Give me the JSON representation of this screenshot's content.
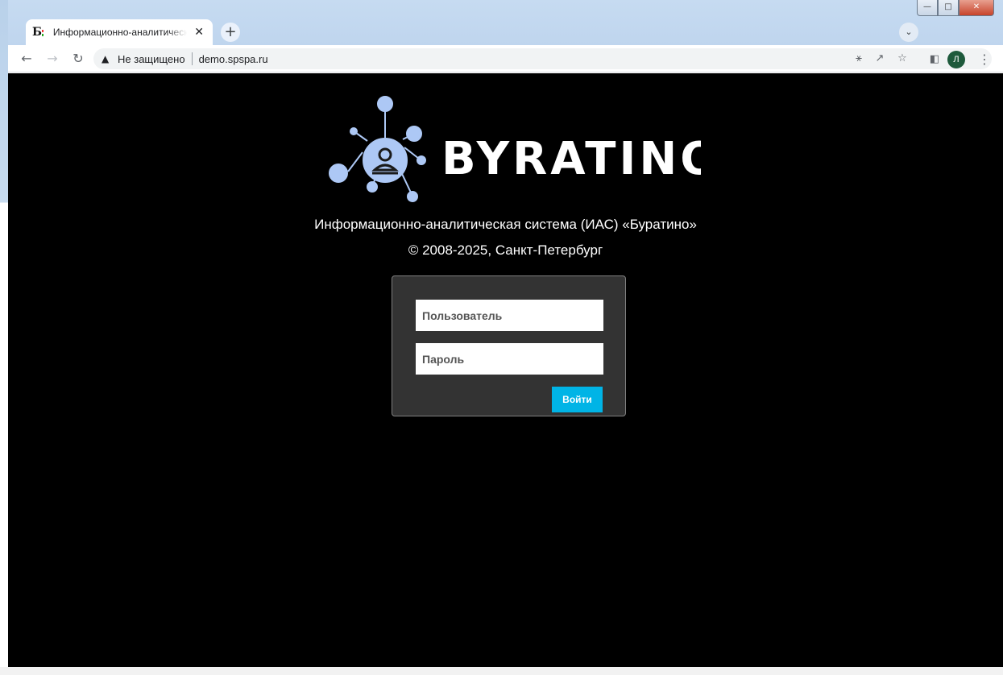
{
  "browser": {
    "tab": {
      "favicon_glyph": "Б",
      "title": "Информационно-аналитическая система (ИАС) «Буратино»",
      "close_glyph": "✕"
    },
    "new_tab_glyph": "+",
    "address_bar": {
      "security_label": "Не защищено",
      "url": "demo.spspa.ru"
    },
    "profile_initial": "Л",
    "icons": [
      "back-icon",
      "forward-icon",
      "reload-icon",
      "warning-icon",
      "key-icon",
      "share-icon",
      "star-icon",
      "side-panel-icon",
      "menu-icon",
      "tab-search-icon"
    ]
  },
  "page": {
    "background": "#000000",
    "logo": {
      "wordmark": "BYRATINO",
      "accent_color": "#adc8f5"
    },
    "title": "Информационно-аналитическая система (ИАС) «Буратино»",
    "copyright": "© 2008-2025, Санкт-Петербург",
    "login_form": {
      "username_placeholder": "Пользователь",
      "password_placeholder": "Пароль",
      "submit_label": "Войти",
      "submit_color": "#00b4e6"
    }
  }
}
